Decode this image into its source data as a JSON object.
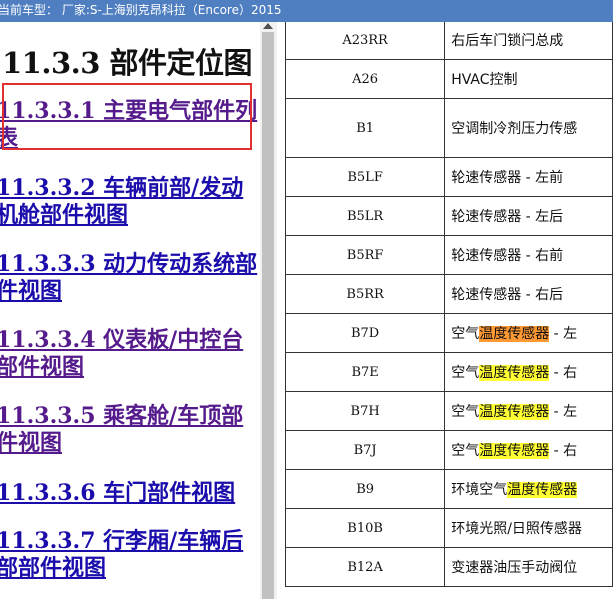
{
  "header": {
    "title": "当前车型： 厂家:S-上海别克昂科拉（Encore）2015"
  },
  "nav": {
    "section_title": "11.3.3 部件定位图",
    "links": [
      {
        "label": "11.3.3.1 主要电气部件列表"
      },
      {
        "label": "11.3.3.2 车辆前部/发动机舱部件视图"
      },
      {
        "label": "11.3.3.3 动力传动系统部件视图"
      },
      {
        "label": "11.3.3.4 仪表板/中控台部件视图"
      },
      {
        "label": "11.3.3.5 乘客舱/车顶部件视图"
      },
      {
        "label": "11.3.3.6 车门部件视图"
      },
      {
        "label": "11.3.3.7 行李厢/车辆后部部件视图"
      }
    ]
  },
  "table": {
    "rows": [
      {
        "code": "A23RR",
        "pre": "右后车门锁闩总成",
        "hl": "",
        "post": ""
      },
      {
        "code": "A26",
        "pre": "HVAC控制",
        "hl": "",
        "post": ""
      },
      {
        "code": "B1",
        "pre": "空调制冷剂压力传感",
        "hl": "",
        "post": ""
      },
      {
        "code": "B5LF",
        "pre": "轮速传感器 - 左前",
        "hl": "",
        "post": ""
      },
      {
        "code": "B5LR",
        "pre": "轮速传感器 - 左后",
        "hl": "",
        "post": ""
      },
      {
        "code": "B5RF",
        "pre": "轮速传感器 - 右前",
        "hl": "",
        "post": ""
      },
      {
        "code": "B5RR",
        "pre": "轮速传感器 - 右后",
        "hl": "",
        "post": ""
      },
      {
        "code": "B7D",
        "pre": "空气",
        "hl": "温度传感器",
        "post": " - 左"
      },
      {
        "code": "B7E",
        "pre": "空气",
        "hl": "温度传感器",
        "post": " - 右"
      },
      {
        "code": "B7H",
        "pre": "空气",
        "hl": "温度传感器",
        "post": " - 左"
      },
      {
        "code": "B7J",
        "pre": "空气",
        "hl": "温度传感器",
        "post": " - 右"
      },
      {
        "code": "B9",
        "pre": "环境空气",
        "hl": "温度传感器",
        "post": ""
      },
      {
        "code": "B10B",
        "pre": "环境光照/日照传感器",
        "hl": "",
        "post": ""
      },
      {
        "code": "B12A",
        "pre": "变速器油压手动阀位",
        "hl": "",
        "post": ""
      }
    ]
  },
  "colors": {
    "header_bg": "#4f7fc1",
    "link": "#1a0dab",
    "link_visited": "#551a8b",
    "highlight": "#ffff33",
    "highlight_active": "#ff9933",
    "selection_box": "#e03030"
  }
}
